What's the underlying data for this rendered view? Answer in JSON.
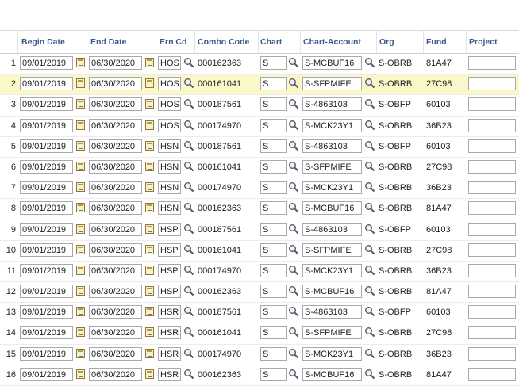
{
  "columns": {
    "begin_date": "Begin Date",
    "end_date": "End Date",
    "ern_cd": "Ern Cd",
    "combo_code": "Combo Code",
    "chart": "Chart",
    "chart_account": "Chart-Account",
    "org": "Org",
    "fund": "Fund",
    "project": "Project"
  },
  "rows": [
    {
      "n": "1",
      "begin": "09/01/2019",
      "end": "06/30/2020",
      "ern": "HOS",
      "combo": "000162363",
      "chart": "S",
      "acct": "S-MCBUF16",
      "org": "S-OBRB",
      "fund": "81A47"
    },
    {
      "n": "2",
      "begin": "09/01/2019",
      "end": "06/30/2020",
      "ern": "HOS",
      "combo": "000161041",
      "chart": "S",
      "acct": "S-SFPMIFE",
      "org": "S-OBRB",
      "fund": "27C98"
    },
    {
      "n": "3",
      "begin": "09/01/2019",
      "end": "06/30/2020",
      "ern": "HOS",
      "combo": "000187561",
      "chart": "S",
      "acct": "S-4863103",
      "org": "S-OBFP",
      "fund": "60103"
    },
    {
      "n": "4",
      "begin": "09/01/2019",
      "end": "06/30/2020",
      "ern": "HOS",
      "combo": "000174970",
      "chart": "S",
      "acct": "S-MCK23Y1",
      "org": "S-OBRB",
      "fund": "36B23"
    },
    {
      "n": "5",
      "begin": "09/01/2019",
      "end": "06/30/2020",
      "ern": "HSN",
      "combo": "000187561",
      "chart": "S",
      "acct": "S-4863103",
      "org": "S-OBFP",
      "fund": "60103"
    },
    {
      "n": "6",
      "begin": "09/01/2019",
      "end": "06/30/2020",
      "ern": "HSN",
      "combo": "000161041",
      "chart": "S",
      "acct": "S-SFPMIFE",
      "org": "S-OBRB",
      "fund": "27C98"
    },
    {
      "n": "7",
      "begin": "09/01/2019",
      "end": "06/30/2020",
      "ern": "HSN",
      "combo": "000174970",
      "chart": "S",
      "acct": "S-MCK23Y1",
      "org": "S-OBRB",
      "fund": "36B23"
    },
    {
      "n": "8",
      "begin": "09/01/2019",
      "end": "06/30/2020",
      "ern": "HSN",
      "combo": "000162363",
      "chart": "S",
      "acct": "S-MCBUF16",
      "org": "S-OBRB",
      "fund": "81A47"
    },
    {
      "n": "9",
      "begin": "09/01/2019",
      "end": "06/30/2020",
      "ern": "HSP",
      "combo": "000187561",
      "chart": "S",
      "acct": "S-4863103",
      "org": "S-OBFP",
      "fund": "60103"
    },
    {
      "n": "10",
      "begin": "09/01/2019",
      "end": "06/30/2020",
      "ern": "HSP",
      "combo": "000161041",
      "chart": "S",
      "acct": "S-SFPMIFE",
      "org": "S-OBRB",
      "fund": "27C98"
    },
    {
      "n": "11",
      "begin": "09/01/2019",
      "end": "06/30/2020",
      "ern": "HSP",
      "combo": "000174970",
      "chart": "S",
      "acct": "S-MCK23Y1",
      "org": "S-OBRB",
      "fund": "36B23"
    },
    {
      "n": "12",
      "begin": "09/01/2019",
      "end": "06/30/2020",
      "ern": "HSP",
      "combo": "000162363",
      "chart": "S",
      "acct": "S-MCBUF16",
      "org": "S-OBRB",
      "fund": "81A47"
    },
    {
      "n": "13",
      "begin": "09/01/2019",
      "end": "06/30/2020",
      "ern": "HSR",
      "combo": "000187561",
      "chart": "S",
      "acct": "S-4863103",
      "org": "S-OBFP",
      "fund": "60103"
    },
    {
      "n": "14",
      "begin": "09/01/2019",
      "end": "06/30/2020",
      "ern": "HSR",
      "combo": "000161041",
      "chart": "S",
      "acct": "S-SFPMIFE",
      "org": "S-OBRB",
      "fund": "27C98"
    },
    {
      "n": "15",
      "begin": "09/01/2019",
      "end": "06/30/2020",
      "ern": "HSR",
      "combo": "000174970",
      "chart": "S",
      "acct": "S-MCK23Y1",
      "org": "S-OBRB",
      "fund": "36B23"
    },
    {
      "n": "16",
      "begin": "09/01/2019",
      "end": "06/30/2020",
      "ern": "HSR",
      "combo": "000162363",
      "chart": "S",
      "acct": "S-MCBUF16",
      "org": "S-OBRB",
      "fund": "81A47"
    }
  ],
  "highlighted_row": 2,
  "icons": {
    "calendar": "calendar-icon",
    "lookup": "magnifier-icon"
  },
  "colors": {
    "header_text": "#3a5a8a",
    "highlight_row": "#fbf7c9",
    "input_border": "#a9a9a9"
  }
}
